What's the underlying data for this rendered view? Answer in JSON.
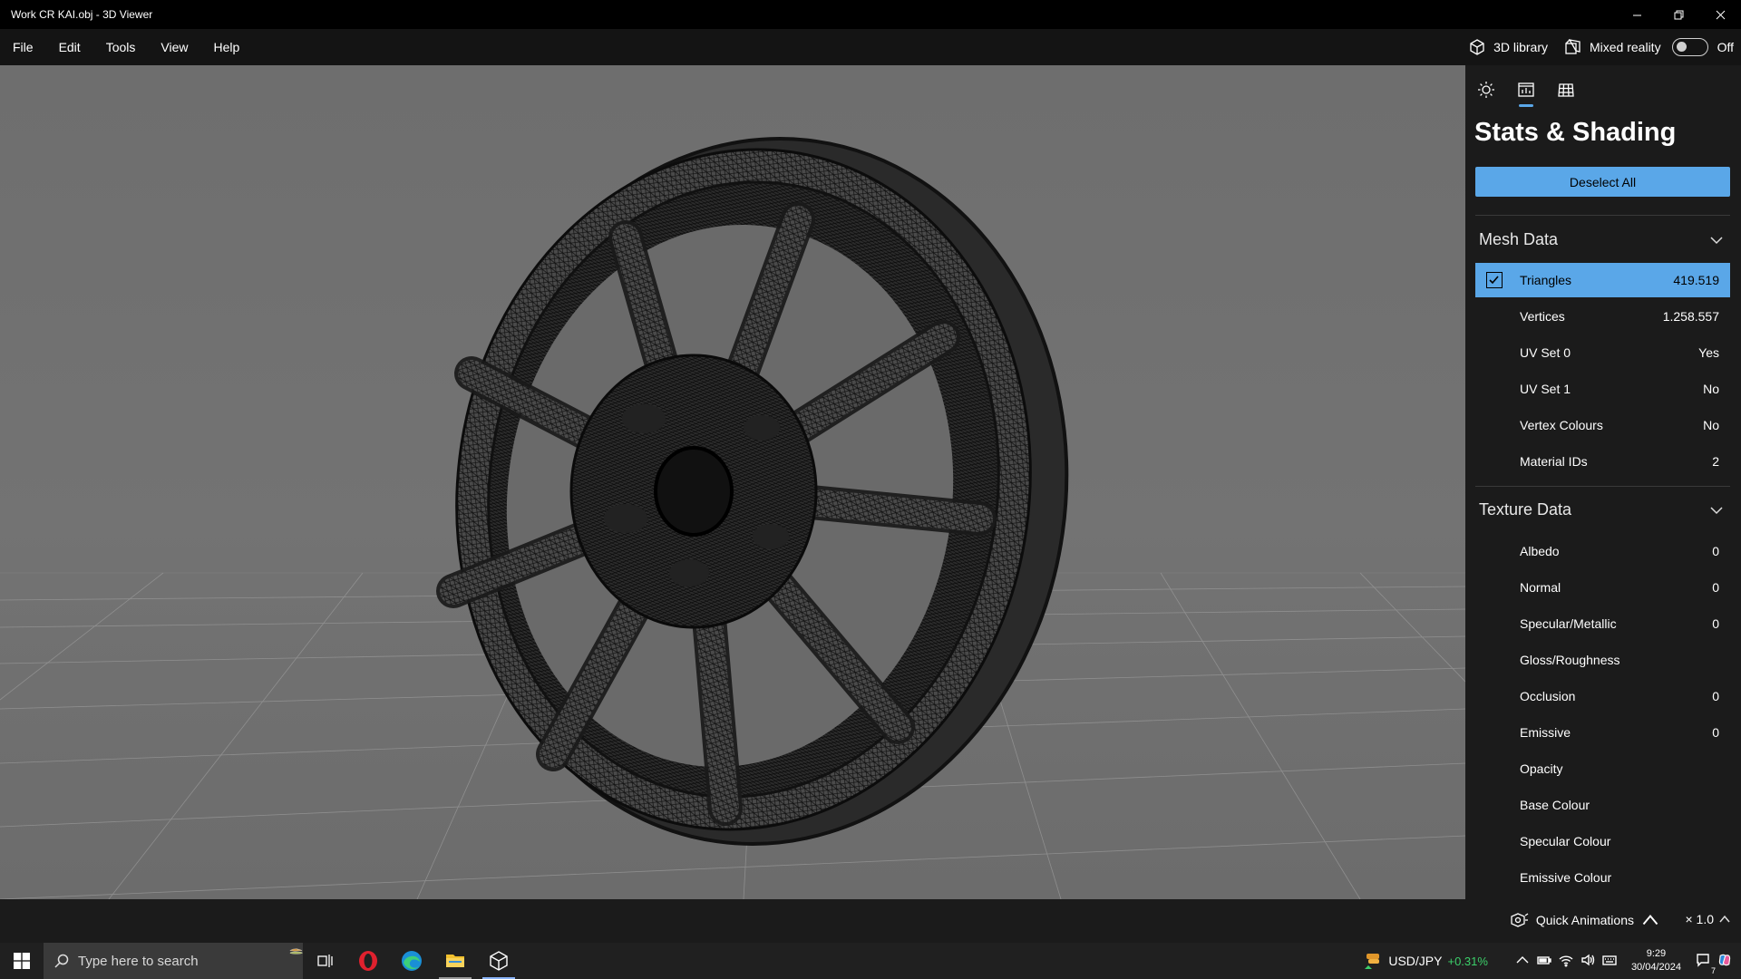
{
  "window": {
    "title": "Work CR KAI.obj - 3D Viewer"
  },
  "menu": {
    "items": [
      "File",
      "Edit",
      "Tools",
      "View",
      "Help"
    ],
    "library_label": "3D library",
    "mixed_reality_label": "Mixed reality",
    "mixed_reality_state": "Off"
  },
  "panel": {
    "title": "Stats & Shading",
    "deselect_label": "Deselect All",
    "mesh": {
      "heading": "Mesh Data",
      "rows": [
        {
          "label": "Triangles",
          "value": "419.519"
        },
        {
          "label": "Vertices",
          "value": "1.258.557"
        },
        {
          "label": "UV Set 0",
          "value": "Yes"
        },
        {
          "label": "UV Set 1",
          "value": "No"
        },
        {
          "label": "Vertex Colours",
          "value": "No"
        },
        {
          "label": "Material IDs",
          "value": "2"
        }
      ]
    },
    "texture": {
      "heading": "Texture Data",
      "rows": [
        {
          "label": "Albedo",
          "value": "0"
        },
        {
          "label": "Normal",
          "value": "0"
        },
        {
          "label": "Specular/Metallic",
          "value": "0"
        },
        {
          "label": "Gloss/Roughness",
          "value": ""
        },
        {
          "label": "Occlusion",
          "value": "0"
        },
        {
          "label": "Emissive",
          "value": "0"
        },
        {
          "label": "Opacity",
          "value": ""
        },
        {
          "label": "Base Colour",
          "value": ""
        },
        {
          "label": "Specular Colour",
          "value": ""
        },
        {
          "label": "Emissive Colour",
          "value": ""
        }
      ]
    }
  },
  "bottom": {
    "quick_animations": "Quick Animations",
    "speed": "× 1.0"
  },
  "taskbar": {
    "search_placeholder": "Type here to search",
    "ticker_symbol": "USD/JPY",
    "ticker_change": "+0.31%",
    "time": "9:29",
    "date": "30/04/2024",
    "notification_count": "7"
  },
  "colors": {
    "accent": "#5aa7e8",
    "panel_bg": "#1b1b1b",
    "viewport_bg": "#707070"
  }
}
